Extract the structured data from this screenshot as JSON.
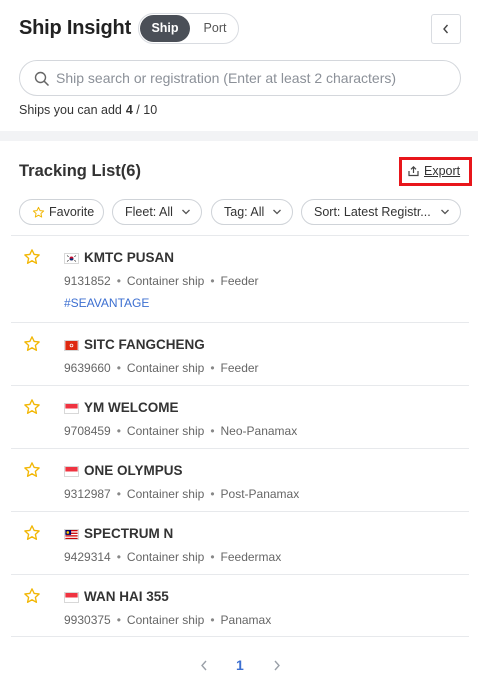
{
  "header": {
    "title": "Ship Insight",
    "toggle": {
      "active": "Ship",
      "inactive": "Port"
    },
    "collapse_icon": "chevron-left-icon"
  },
  "search": {
    "placeholder": "Ship search or registration (Enter at least 2 characters)",
    "value": ""
  },
  "quota": {
    "label": "Ships you can add",
    "current": "4",
    "separator": "/",
    "max": "10"
  },
  "tracking": {
    "title": "Tracking List(6)",
    "export_label": "Export",
    "highlight_color": "#e8161b"
  },
  "filters": [
    {
      "label": "Favorite",
      "icon": "star-outline-icon"
    },
    {
      "label": "Fleet: All",
      "icon": "chevron-down-icon"
    },
    {
      "label": "Tag: All",
      "icon": "chevron-down-icon"
    },
    {
      "label": "Sort: Latest Registr...",
      "icon": "chevron-down-icon"
    }
  ],
  "ships": [
    {
      "name": "KMTC PUSAN",
      "registration": "9131852",
      "type": "Container ship",
      "class": "Feeder",
      "flag": "KR",
      "tag": "#SEAVANTAGE"
    },
    {
      "name": "SITC FANGCHENG",
      "registration": "9639660",
      "type": "Container ship",
      "class": "Feeder",
      "flag": "HK"
    },
    {
      "name": "YM WELCOME",
      "registration": "9708459",
      "type": "Container ship",
      "class": "Neo-Panamax",
      "flag": "SG"
    },
    {
      "name": "ONE OLYMPUS",
      "registration": "9312987",
      "type": "Container ship",
      "class": "Post-Panamax",
      "flag": "SG"
    },
    {
      "name": "SPECTRUM N",
      "registration": "9429314",
      "type": "Container ship",
      "class": "Feedermax",
      "flag": "MY"
    },
    {
      "name": "WAN HAI 355",
      "registration": "9930375",
      "type": "Container ship",
      "class": "Panamax",
      "flag": "SG"
    }
  ],
  "pagination": {
    "current": "1"
  },
  "colors": {
    "accent": "#3c6fd1",
    "star": "#f2b705",
    "toggle_active_bg": "#4a4f57"
  }
}
